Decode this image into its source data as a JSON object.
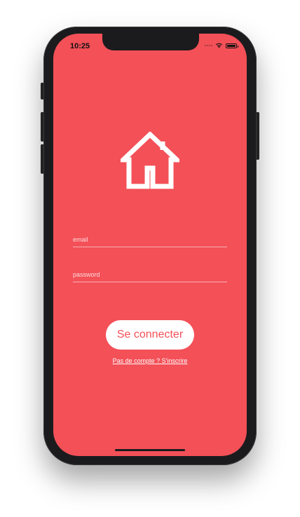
{
  "status_bar": {
    "time": "10:25",
    "icons": [
      "signal-icon",
      "wifi-icon",
      "battery-icon"
    ]
  },
  "logo": {
    "icon": "house-icon"
  },
  "form": {
    "email_placeholder": "email",
    "email_value": "",
    "password_placeholder": "password",
    "password_value": ""
  },
  "actions": {
    "login_label": "Se connecter",
    "signup_label": "Pas de compte ? S'inscrire"
  },
  "colors": {
    "background": "#f35058",
    "accent": "#ffffff",
    "device": "#1b1b1d"
  }
}
